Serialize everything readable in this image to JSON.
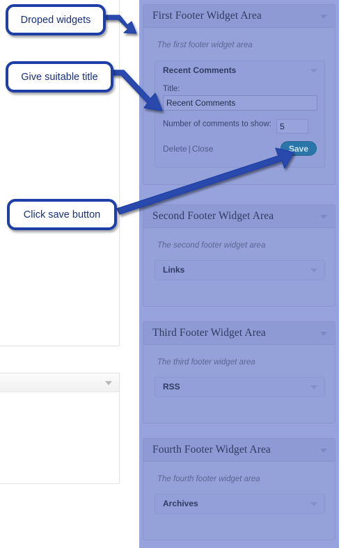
{
  "annotations": [
    {
      "id": "dropped-widgets",
      "text": "Droped widgets"
    },
    {
      "id": "give-suitable-title",
      "text": "Give suitable title"
    },
    {
      "id": "click-save-button",
      "text": "Click save button"
    }
  ],
  "widget_areas": [
    {
      "title": "First Footer Widget Area",
      "description": "The first footer widget area",
      "widget": {
        "name": "Recent Comments",
        "expanded": true,
        "title_label": "Title:",
        "title_value": "Recent Comments",
        "count_label": "Number of comments to show:",
        "count_value": "5",
        "delete_label": "Delete",
        "separator": "|",
        "close_label": "Close",
        "save_label": "Save"
      }
    },
    {
      "title": "Second Footer Widget Area",
      "description": "The second footer widget area",
      "widget": {
        "name": "Links",
        "expanded": false
      }
    },
    {
      "title": "Third Footer Widget Area",
      "description": "The third footer widget area",
      "widget": {
        "name": "RSS",
        "expanded": false
      }
    },
    {
      "title": "Fourth Footer Widget Area",
      "description": "The fourth footer widget area",
      "widget": {
        "name": "Archives",
        "expanded": false
      }
    }
  ],
  "colors": {
    "overlay_panel": "#96a3dc",
    "panel_header": "#8d9ad4",
    "annotation_blue": "#1f3fa8",
    "save_button": "#2b76a8",
    "heading_text": "#2f3b61"
  }
}
